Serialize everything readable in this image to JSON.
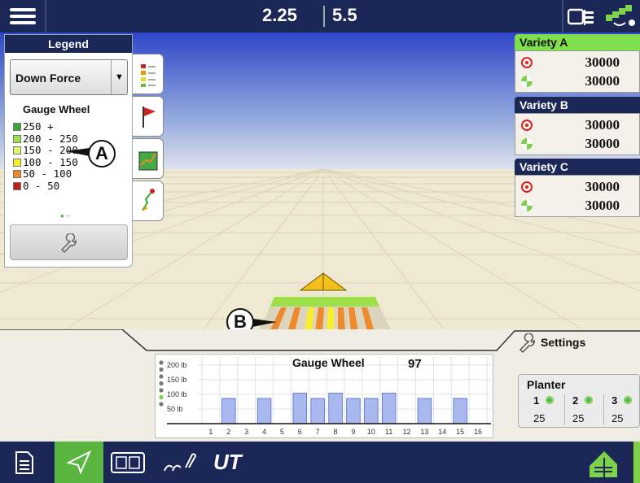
{
  "topbar": {
    "value_left": "2.25",
    "value_right": "5.5"
  },
  "legend": {
    "title": "Legend",
    "selected_layer": "Down Force",
    "subtitle": "Gauge Wheel",
    "ranges": [
      {
        "label": "250 +",
        "color": "#3ea43a"
      },
      {
        "label": "200 - 250",
        "color": "#9ee04a"
      },
      {
        "label": "150 - 200",
        "color": "#e3f56a"
      },
      {
        "label": "100 - 150",
        "color": "#f8ef2a"
      },
      {
        "label": "50 - 100",
        "color": "#ee8a2b"
      },
      {
        "label": "0 - 50",
        "color": "#c21b1b"
      }
    ]
  },
  "products": [
    {
      "name": "Variety A",
      "header_color": "#7fe04d",
      "target_rate": "30000",
      "applied_rate": "30000"
    },
    {
      "name": "Variety B",
      "header_color": "#1b2756",
      "target_rate": "30000",
      "applied_rate": "30000"
    },
    {
      "name": "Variety C",
      "header_color": "#1b2756",
      "target_rate": "30000",
      "applied_rate": "30000"
    }
  ],
  "callouts": {
    "a": "A",
    "b": "B"
  },
  "settings": {
    "label": "Settings"
  },
  "planter": {
    "title": "Planter",
    "sections": [
      {
        "id": "1",
        "value": "25"
      },
      {
        "id": "2",
        "value": "25"
      },
      {
        "id": "3",
        "value": "25"
      }
    ]
  },
  "chart_data": {
    "type": "bar",
    "title": "Gauge Wheel",
    "current_value": "97",
    "categories": [
      "1",
      "2",
      "3",
      "4",
      "5",
      "6",
      "7",
      "8",
      "9",
      "10",
      "11",
      "12",
      "13",
      "14",
      "15",
      "16"
    ],
    "values": [
      0,
      86,
      0,
      86,
      0,
      104,
      86,
      104,
      86,
      86,
      104,
      0,
      86,
      0,
      86,
      0
    ],
    "ytick_labels": [
      "50 lb",
      "100 lb",
      "150 lb",
      "200 lb"
    ],
    "yticks": [
      50,
      100,
      150,
      200
    ],
    "ylim": [
      0,
      230
    ],
    "bar_color": "#a9b9ef",
    "grid": true
  }
}
